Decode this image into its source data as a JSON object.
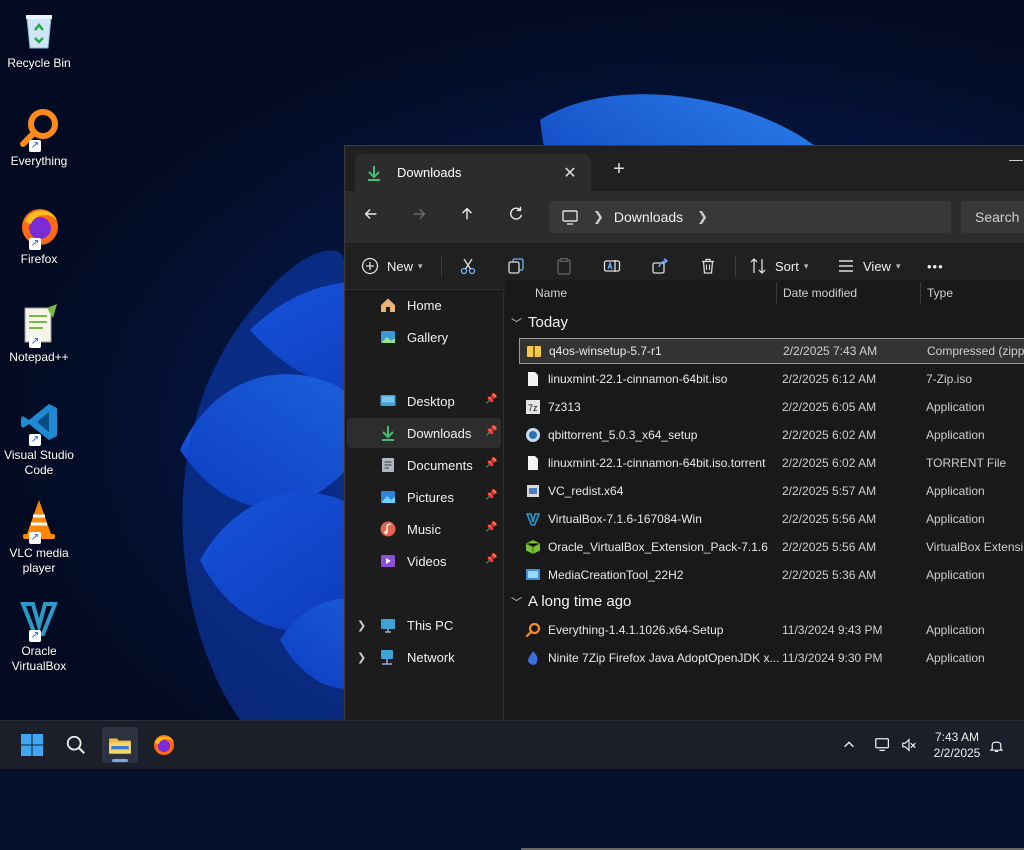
{
  "desktop": {
    "icons": [
      {
        "label": "Recycle Bin",
        "icon": "recycle-bin-icon"
      },
      {
        "label": "Everything",
        "icon": "everything-icon"
      },
      {
        "label": "Firefox",
        "icon": "firefox-icon"
      },
      {
        "label": "Notepad++",
        "icon": "notepad-plus-plus-icon"
      },
      {
        "label": "Visual Studio Code",
        "icon": "vscode-icon"
      },
      {
        "label": "VLC media player",
        "icon": "vlc-icon"
      },
      {
        "label": "Oracle VirtualBox",
        "icon": "virtualbox-icon"
      }
    ]
  },
  "explorer": {
    "tab_title": "Downloads",
    "tab_close": "✕",
    "new_tab": "+",
    "address": {
      "segment": "Downloads"
    },
    "search_placeholder": "Search Downloads",
    "toolbar": {
      "new_label": "New",
      "sort_label": "Sort",
      "view_label": "View",
      "more_label": "•••"
    },
    "nav_pane": {
      "home": "Home",
      "gallery": "Gallery",
      "desktop": "Desktop",
      "downloads": "Downloads",
      "documents": "Documents",
      "pictures": "Pictures",
      "music": "Music",
      "videos": "Videos",
      "this_pc": "This PC",
      "network": "Network"
    },
    "columns": {
      "name": "Name",
      "date": "Date modified",
      "type": "Type"
    },
    "groups": [
      {
        "title": "Today",
        "files": [
          {
            "name": "q4os-winsetup-5.7-r1",
            "date": "2/2/2025 7:43 AM",
            "type": "Compressed (zipp...",
            "icon": "zip-folder-icon"
          },
          {
            "name": "linuxmint-22.1-cinnamon-64bit.iso",
            "date": "2/2/2025 6:12 AM",
            "type": "7-Zip.iso",
            "icon": "file-icon"
          },
          {
            "name": "7z313",
            "date": "2/2/2025 6:05 AM",
            "type": "Application",
            "icon": "7zip-icon"
          },
          {
            "name": "qbittorrent_5.0.3_x64_setup",
            "date": "2/2/2025 6:02 AM",
            "type": "Application",
            "icon": "qbittorrent-icon"
          },
          {
            "name": "linuxmint-22.1-cinnamon-64bit.iso.torrent",
            "date": "2/2/2025 6:02 AM",
            "type": "TORRENT File",
            "icon": "file-icon"
          },
          {
            "name": "VC_redist.x64",
            "date": "2/2/2025 5:57 AM",
            "type": "Application",
            "icon": "installer-icon"
          },
          {
            "name": "VirtualBox-7.1.6-167084-Win",
            "date": "2/2/2025 5:56 AM",
            "type": "Application",
            "icon": "virtualbox-icon"
          },
          {
            "name": "Oracle_VirtualBox_Extension_Pack-7.1.6",
            "date": "2/2/2025 5:56 AM",
            "type": "VirtualBox Extensi...",
            "icon": "extension-pack-icon"
          },
          {
            "name": "MediaCreationTool_22H2",
            "date": "2/2/2025 5:36 AM",
            "type": "Application",
            "icon": "media-creation-icon"
          }
        ]
      },
      {
        "title": "A long time ago",
        "files": [
          {
            "name": "Everything-1.4.1.1026.x64-Setup",
            "date": "11/3/2024 9:43 PM",
            "type": "Application",
            "icon": "everything-icon"
          },
          {
            "name": "Ninite 7Zip Firefox Java AdoptOpenJDK x...",
            "date": "11/3/2024 9:30 PM",
            "type": "Application",
            "icon": "ninite-icon"
          }
        ]
      }
    ]
  },
  "taskbar": {
    "time": "7:43 AM",
    "date": "2/2/2025"
  },
  "colors": {
    "accent": "#2b7de0",
    "taskbar_bg": "#1b1f2a",
    "window_bg": "#1c1c1c"
  }
}
